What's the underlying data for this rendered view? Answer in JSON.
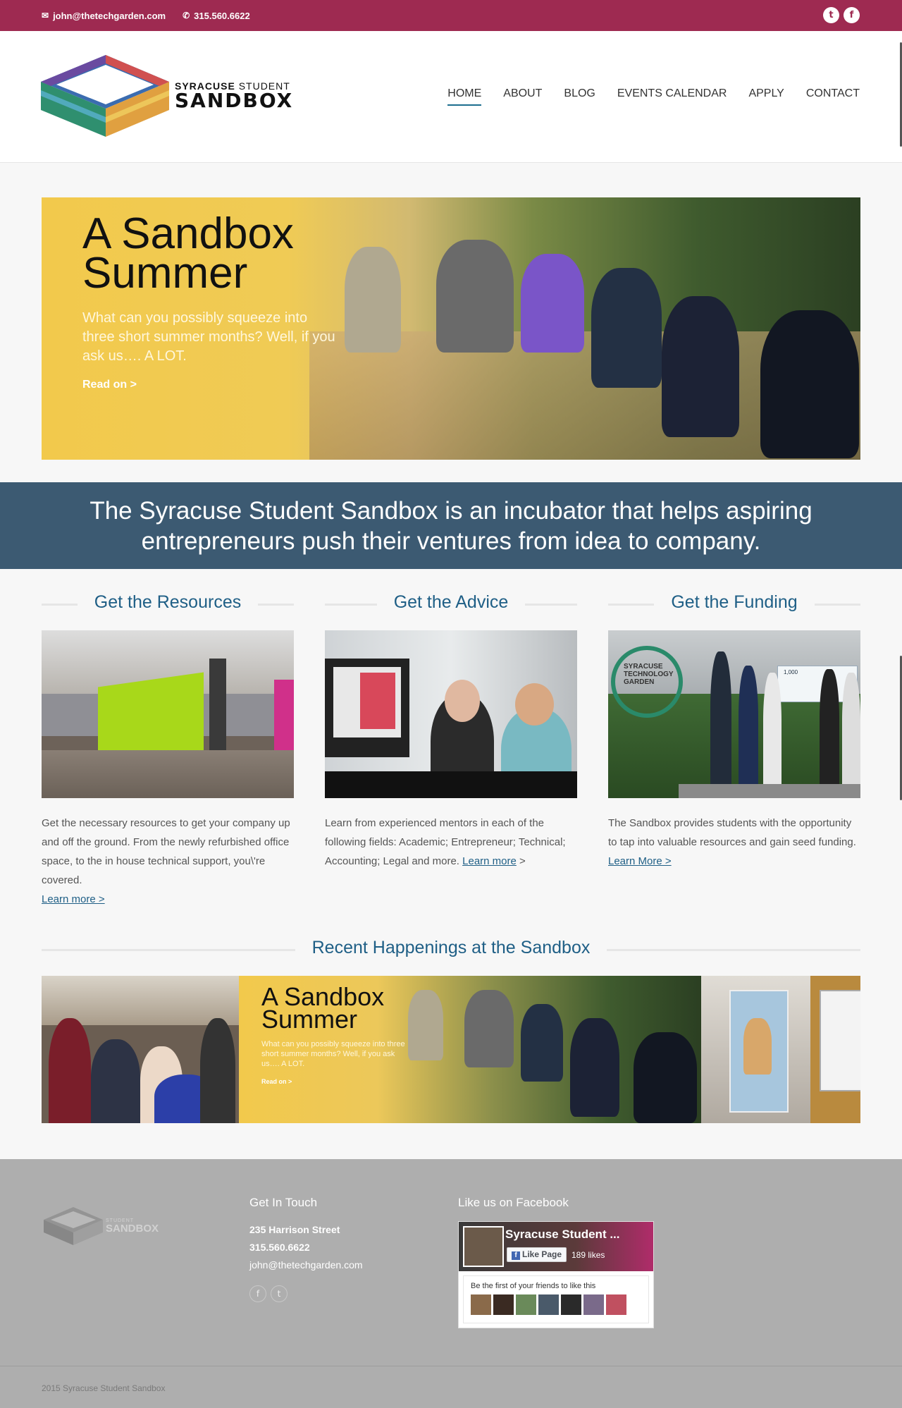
{
  "topbar": {
    "email": "john@thetechgarden.com",
    "phone": "315.560.6622",
    "icons": {
      "mail": "envelope-icon",
      "phone": "phone-icon",
      "twitter": "twitter-icon",
      "facebook": "facebook-icon"
    }
  },
  "header": {
    "logo_line1_a": "SYRACUSE",
    "logo_line1_b": "STUDENT",
    "logo_line2": "SANDBOX",
    "nav": [
      "HOME",
      "ABOUT",
      "BLOG",
      "EVENTS CALENDAR",
      "APPLY",
      "CONTACT"
    ],
    "active_nav": "HOME"
  },
  "hero": {
    "title_line1": "A Sandbox",
    "title_line2": "Summer",
    "subtitle": "What can you possibly squeeze into three short summer months? Well, if you ask us…. A LOT.",
    "link": "Read on >"
  },
  "mission": {
    "text": "The Syracuse Student Sandbox is an incubator that helps aspiring entrepreneurs push their ventures from idea to company."
  },
  "columns": [
    {
      "title": "Get the Resources",
      "text": "Get the necessary resources to get your company up and off the ground. From the newly refurbished office space, to the in house technical support, you\\'re covered.",
      "link": "Learn more >",
      "link_suffix": ""
    },
    {
      "title": "Get the Advice",
      "text": "Learn from experienced mentors in each of the following fields: Academic; Entrepreneur; Technical; Accounting; Legal and more.",
      "link": "Learn more",
      "link_suffix": " >"
    },
    {
      "title": "Get the Funding",
      "text": "The Sandbox provides students with the opportunity to tap into valuable resources and gain seed funding.",
      "link": "Learn More >",
      "link_suffix": ""
    }
  ],
  "funding_img": {
    "sign_line1": "SYRACUSE",
    "sign_line2": "TECHNOLOGY",
    "sign_line3": "GARDEN",
    "check_amount": "1,000"
  },
  "recent": {
    "title": "Recent Happenings at the Sandbox",
    "slide_title_line1": "A Sandbox",
    "slide_title_line2": "Summer",
    "slide_sub": "What can you possibly squeeze into three short summer months? Well, if you ask us…. A LOT.",
    "slide_link": "Read on >"
  },
  "footer": {
    "logo_small": "STUDENT",
    "logo_big": "SANDBOX",
    "contact_title": "Get In Touch",
    "address": "235 Harrison Street",
    "phone": "315.560.6622",
    "email": "john@thetechgarden.com",
    "facebook_title": "Like us on Facebook",
    "fb_page_name": "Syracuse Student ...",
    "fb_like_label": "Like Page",
    "fb_likes": "189 likes",
    "fb_friends_text": "Be the first of your friends to like this",
    "copyright": "2015 Syracuse Student Sandbox"
  },
  "colors": {
    "topbar": "#9e2a51",
    "mission_band": "#3c5a72",
    "heading_blue": "#1f5f86",
    "footer": "#aeaeae"
  }
}
